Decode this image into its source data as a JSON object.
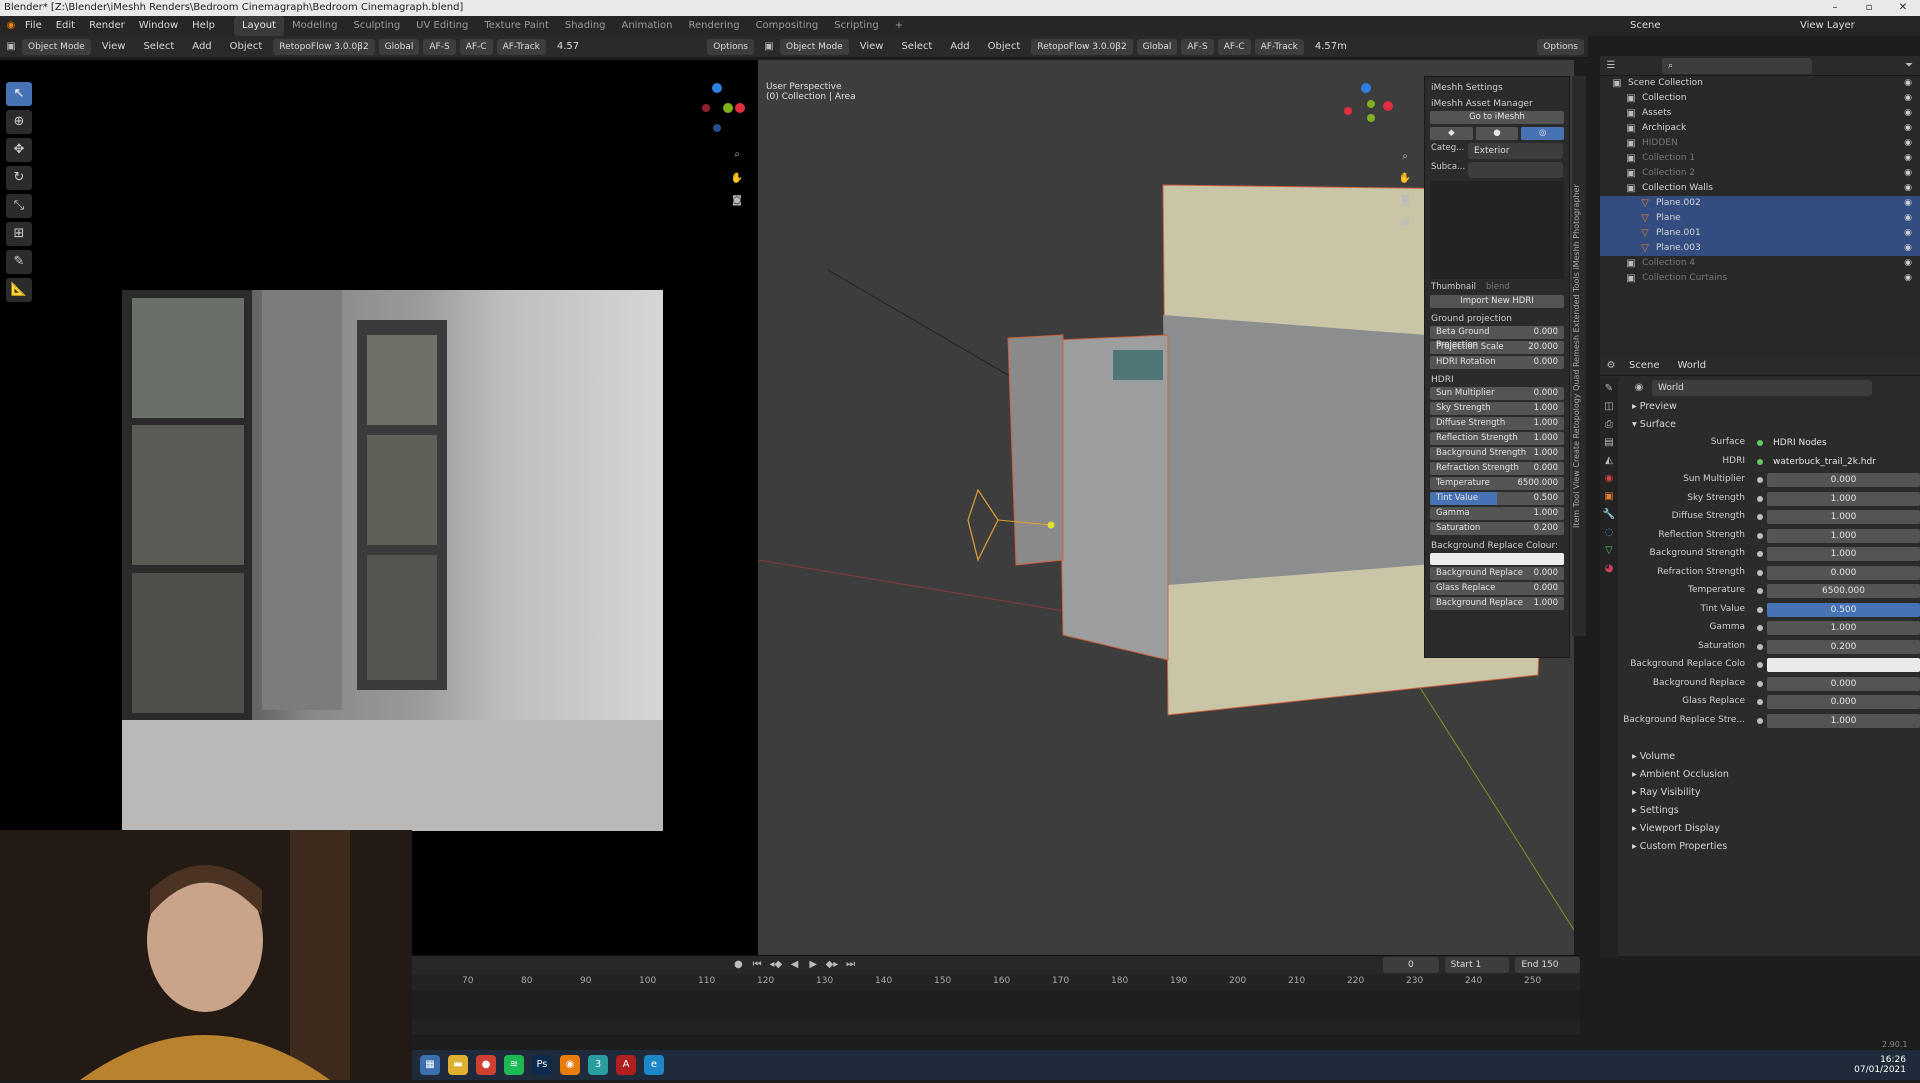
{
  "titlebar": {
    "title": "Blender* [Z:\\Blender\\iMeshh Renders\\Bedroom Cinemagraph\\Bedroom Cinemagraph.blend]",
    "min": "–",
    "max": "▫",
    "close": "✕"
  },
  "menu": [
    "File",
    "Edit",
    "Render",
    "Window",
    "Help"
  ],
  "workspaces": [
    "Layout",
    "Modeling",
    "Sculpting",
    "UV Editing",
    "Texture Paint",
    "Shading",
    "Animation",
    "Rendering",
    "Compositing",
    "Scripting"
  ],
  "top_right": {
    "scene": "Scene",
    "view_layer": "View Layer"
  },
  "left_header": {
    "mode": "Object Mode",
    "view": "View",
    "select": "Select",
    "add": "Add",
    "object": "Object",
    "retopo": "RetopoFlow 3.0.0β2",
    "global": "Global",
    "options": "Options",
    "af_s": "AF-S",
    "af_c": "AF-C",
    "af_track": "AF-Track",
    "focal": "4.57"
  },
  "right_header": {
    "mode": "Object Mode",
    "view": "View",
    "select": "Select",
    "add": "Add",
    "object": "Object",
    "retopo": "RetopoFlow 3.0.0β2",
    "global": "Global",
    "options": "Options",
    "af_s": "AF-S",
    "af_c": "AF-C",
    "af_track": "AF-Track",
    "focal": "4.57m"
  },
  "viewport_overlay": {
    "line1": "User Perspective",
    "line2": "(0) Collection | Area"
  },
  "npanel": {
    "settings": "iMeshh Settings",
    "asset_manager": "iMeshh Asset Manager",
    "go_to": "Go to iMeshh",
    "category_label": "Categ...",
    "category_value": "Exterior",
    "subcategory_label": "Subca...",
    "thumbnail": "Thumbnail",
    "blend": "blend",
    "import_hdri": "Import New HDRI",
    "ground_projection_title": "Ground projection",
    "ground_rows": [
      {
        "label": "Beta Ground Projection",
        "value": "0.000"
      },
      {
        "label": "Projection Scale",
        "value": "20.000"
      },
      {
        "label": "HDRI Rotation",
        "value": "0.000"
      }
    ],
    "hdri_title": "HDRI",
    "hdri_rows": [
      {
        "label": "Sun Multiplier",
        "value": "0.000"
      },
      {
        "label": "Sky Strength",
        "value": "1.000"
      },
      {
        "label": "Diffuse Strength",
        "value": "1.000"
      },
      {
        "label": "Reflection Strength",
        "value": "1.000"
      },
      {
        "label": "Background Strength",
        "value": "1.000"
      },
      {
        "label": "Refraction Strength",
        "value": "0.000"
      },
      {
        "label": "Temperature",
        "value": "6500.000"
      },
      {
        "label": "Tint Value",
        "value": "0.500"
      },
      {
        "label": "Gamma",
        "value": "1.000"
      },
      {
        "label": "Saturation",
        "value": "0.200"
      }
    ],
    "bg_replace_colour": "Background Replace Colour:",
    "bottom_rows": [
      {
        "label": "Background Replace",
        "value": "0.000"
      },
      {
        "label": "Glass Replace",
        "value": "0.000"
      },
      {
        "label": "Background Replace",
        "value": "1.000"
      }
    ]
  },
  "side_tabs": "Item Tool View Create Retopology Quad Remesh Extended Tools iMeshh Photographer",
  "outliner": {
    "rows": [
      {
        "label": "Scene Collection",
        "indent": 0,
        "state": ""
      },
      {
        "label": "Collection",
        "indent": 1,
        "state": ""
      },
      {
        "label": "Assets",
        "indent": 1,
        "state": ""
      },
      {
        "label": "Archipack",
        "indent": 1,
        "state": ""
      },
      {
        "label": "HIDDEN",
        "indent": 1,
        "state": "dim"
      },
      {
        "label": "Collection 1",
        "indent": 1,
        "state": "dim"
      },
      {
        "label": "Collection 2",
        "indent": 1,
        "state": "dim"
      },
      {
        "label": "Collection Walls",
        "indent": 1,
        "state": ""
      },
      {
        "label": "Plane.002",
        "indent": 2,
        "state": "sel"
      },
      {
        "label": "Plane",
        "indent": 2,
        "state": "sel"
      },
      {
        "label": "Plane.001",
        "indent": 2,
        "state": "sel"
      },
      {
        "label": "Plane.003",
        "indent": 2,
        "state": "sel"
      },
      {
        "label": "Collection 4",
        "indent": 1,
        "state": "dim"
      },
      {
        "label": "Collection Curtains",
        "indent": 1,
        "state": "dim"
      }
    ]
  },
  "properties": {
    "scene_tab": "Scene",
    "world_tab": "World",
    "world_name": "World",
    "preview": "Preview",
    "surface": "Surface",
    "rows": [
      {
        "label": "Surface",
        "value": "HDRI Nodes",
        "style": "plain"
      },
      {
        "label": "HDRI",
        "value": "waterbuck_trail_2k.hdr",
        "style": "plain"
      },
      {
        "label": "Sun Multiplier",
        "value": "0.000",
        "style": ""
      },
      {
        "label": "Sky Strength",
        "value": "1.000",
        "style": ""
      },
      {
        "label": "Diffuse Strength",
        "value": "1.000",
        "style": ""
      },
      {
        "label": "Reflection Strength",
        "value": "1.000",
        "style": ""
      },
      {
        "label": "Background Strength",
        "value": "1.000",
        "style": ""
      },
      {
        "label": "Refraction Strength",
        "value": "0.000",
        "style": ""
      },
      {
        "label": "Temperature",
        "value": "6500.000",
        "style": ""
      },
      {
        "label": "Tint Value",
        "value": "0.500",
        "style": "blue"
      },
      {
        "label": "Gamma",
        "value": "1.000",
        "style": ""
      },
      {
        "label": "Saturation",
        "value": "0.200",
        "style": ""
      },
      {
        "label": "Background Replace Colo",
        "value": "",
        "style": "white"
      },
      {
        "label": "Background Replace",
        "value": "0.000",
        "style": ""
      },
      {
        "label": "Glass Replace",
        "value": "0.000",
        "style": ""
      },
      {
        "label": "Background Replace Stre...",
        "value": "1.000",
        "style": ""
      }
    ],
    "sections": [
      "Volume",
      "Ambient Occlusion",
      "Ray Visibility",
      "Settings",
      "Viewport Display",
      "Custom Properties"
    ]
  },
  "timeline": {
    "frame": "0",
    "start_label": "Start",
    "start": "1",
    "end_label": "End",
    "end": "150",
    "ticks": [
      "70",
      "80",
      "90",
      "100",
      "110",
      "120",
      "130",
      "140",
      "150",
      "160",
      "170",
      "180",
      "190",
      "200",
      "210",
      "220",
      "230",
      "240",
      "250"
    ]
  },
  "status": {
    "version": "2.90.1",
    "time": "16:26",
    "date": "07/01/2021"
  }
}
